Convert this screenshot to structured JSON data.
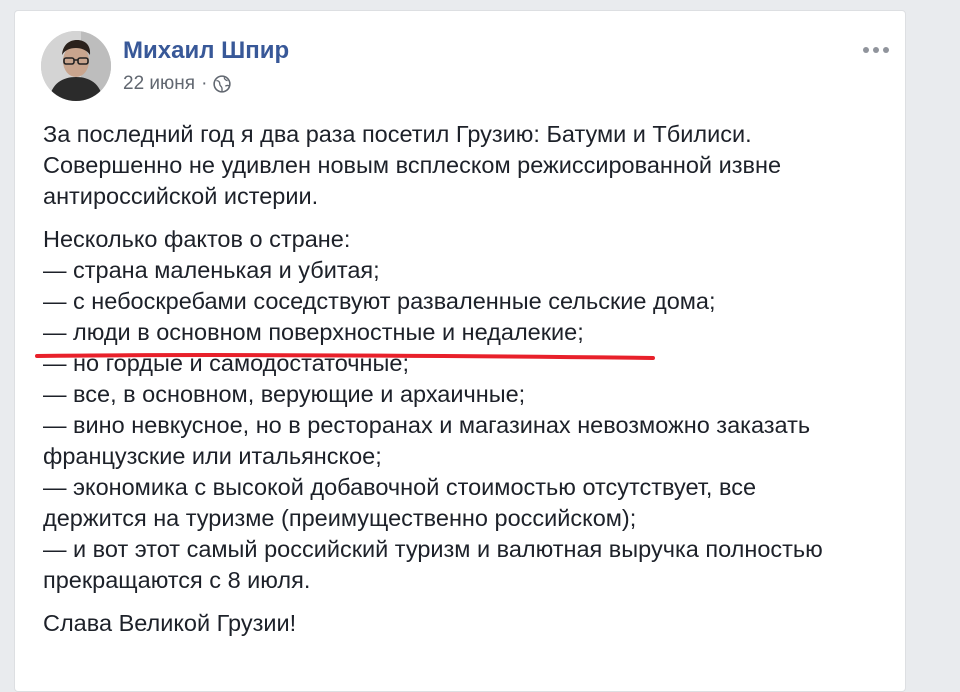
{
  "post": {
    "author": "Михаил Шпир",
    "date": "22 июня",
    "separator": "·",
    "privacy_icon": "globe-icon",
    "more_icon": "more-options-icon",
    "paragraph1": [
      "За последний год я два раза посетил Грузию: Батуми и Тбилиси.",
      "Совершенно не удивлен новым всплеском режиссированной извне",
      "антироссийской истерии."
    ],
    "paragraph2": [
      "Несколько фактов о стране:",
      "— страна маленькая и убитая;",
      "— с небоскребами соседствуют разваленные сельские дома;",
      "— люди в основном поверхностные и недалекие;",
      "— но гордые и самодостаточные;",
      "— все, в основном, верующие и архаичные;",
      "— вино невкусное, но в ресторанах и магазинах невозможно заказать",
      "французские или итальянское;",
      "— экономика с высокой добавочной стоимостью отсутствует, все",
      "держится на туризме (преимущественно российском);",
      "— и вот этот самый российский туризм и валютная выручка полностью",
      "прекращаются с 8 июля."
    ],
    "paragraph3": [
      "Слава Великой Грузии!"
    ]
  },
  "colors": {
    "author_link": "#385898",
    "text": "#1d2129",
    "meta": "#616770",
    "underline": "#e8202a",
    "background": "#e9ebee"
  }
}
